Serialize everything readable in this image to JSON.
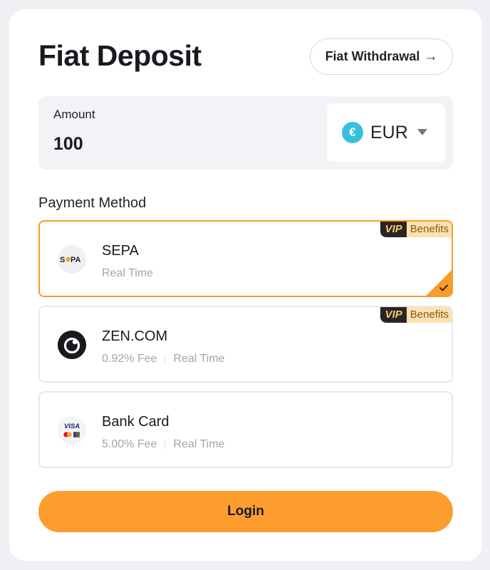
{
  "header": {
    "title": "Fiat Deposit",
    "withdraw_label": "Fiat Withdrawal",
    "withdraw_arrow": "→"
  },
  "amount": {
    "label": "Amount",
    "value": "100"
  },
  "currency": {
    "symbol": "€",
    "code": "EUR",
    "icon_color": "#35c1de"
  },
  "payment": {
    "section_label": "Payment Method",
    "vip_label": "VIP",
    "benefits_label": "Benefits",
    "methods": [
      {
        "name": "SEPA",
        "logo_text": "SEPA",
        "fee": "",
        "speed": "Real Time",
        "selected": true,
        "vip": true,
        "icon": "sepa-logo-icon"
      },
      {
        "name": "ZEN.COM",
        "fee": "0.92% Fee",
        "speed": "Real Time",
        "selected": false,
        "vip": true,
        "icon": "zen-logo-icon"
      },
      {
        "name": "Bank Card",
        "logo_text": "VISA",
        "fee": "5.00% Fee",
        "speed": "Real Time",
        "selected": false,
        "vip": false,
        "icon": "visa-mastercard-jcb-icon"
      }
    ]
  },
  "login": {
    "label": "Login"
  },
  "colors": {
    "accent": "#fc9d2d",
    "selected_border": "#f89c2a",
    "vip_dark": "#2b2520",
    "benefits_bg": "#fde1b0"
  }
}
